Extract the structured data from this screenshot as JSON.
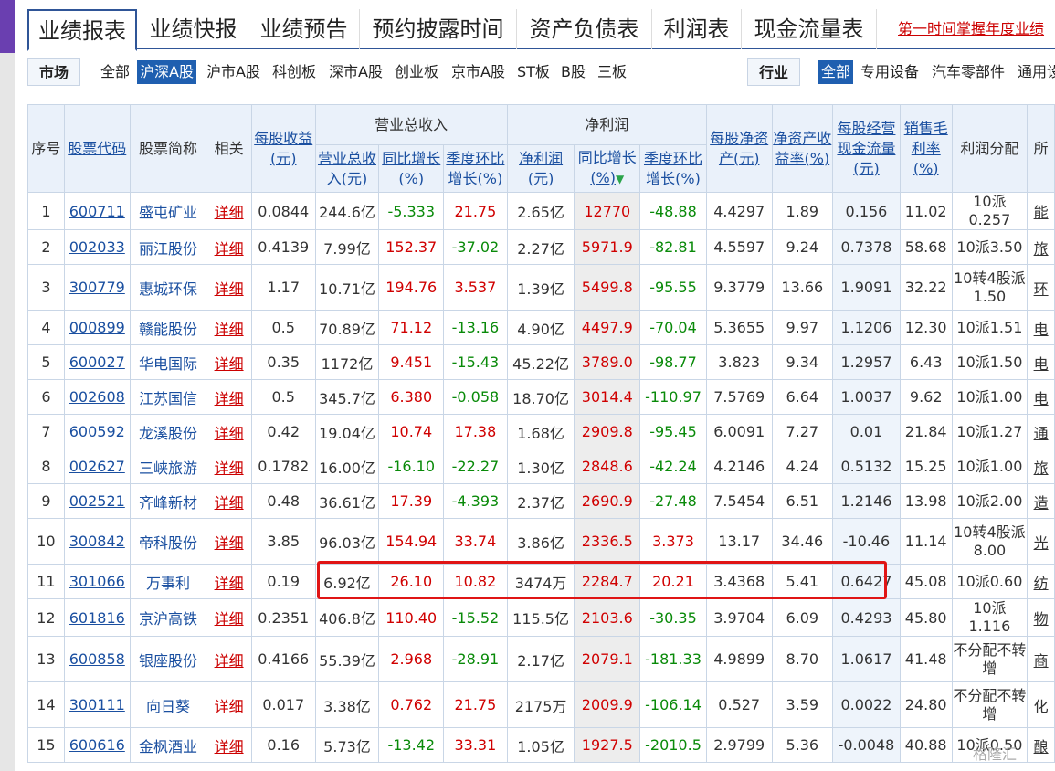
{
  "tabs": [
    "业绩报表",
    "业绩快报",
    "业绩预告",
    "预约披露时间",
    "资产负债表",
    "利润表",
    "现金流量表"
  ],
  "promo": "第一时间掌握年度业绩",
  "market": {
    "label": "市场",
    "items": [
      "全部",
      "沪深A股",
      "沪市A股",
      "科创板",
      "深市A股",
      "创业板",
      "京市A股",
      "ST板",
      "B股",
      "三板"
    ],
    "active": 1
  },
  "industry": {
    "label": "行业",
    "items": [
      "全部",
      "专用设备",
      "汽车零部件",
      "通用设"
    ],
    "active": 0
  },
  "headers": {
    "seq": "序号",
    "code": "股票代码",
    "name": "股票简称",
    "related": "相关",
    "eps": "每股收益(元)",
    "revenue_group": "营业总收入",
    "revenue": "营业总收入(元)",
    "rev_yoy": "同比增长(%)",
    "rev_qoq": "季度环比增长(%)",
    "profit_group": "净利润",
    "profit": "净利润(元)",
    "profit_yoy": "同比增长(%)",
    "profit_qoq": "季度环比增长(%)",
    "bvps": "每股净资产(元)",
    "roe": "净资产收益率(%)",
    "ocfps": "每股经营现金流量(元)",
    "gross": "销售毛利率(%)",
    "dividend": "利润分配",
    "industry": "所"
  },
  "detail_label": "详细",
  "rows": [
    {
      "seq": "1",
      "code": "600711",
      "name": "盛屯矿业",
      "eps": "0.0844",
      "rev": "244.6亿",
      "rev_yoy": "-5.333",
      "rev_qoq": "21.75",
      "profit": "2.65亿",
      "p_yoy": "12770",
      "p_qoq": "-48.88",
      "bvps": "4.4297",
      "roe": "1.89",
      "ocf": "0.156",
      "gross": "11.02",
      "div": "10派0.257",
      "ind": "能"
    },
    {
      "seq": "2",
      "code": "002033",
      "name": "丽江股份",
      "eps": "0.4139",
      "rev": "7.99亿",
      "rev_yoy": "152.37",
      "rev_qoq": "-37.02",
      "profit": "2.27亿",
      "p_yoy": "5971.9",
      "p_qoq": "-82.81",
      "bvps": "4.5597",
      "roe": "9.24",
      "ocf": "0.7378",
      "gross": "58.68",
      "div": "10派3.50",
      "ind": "旅"
    },
    {
      "seq": "3",
      "code": "300779",
      "name": "惠城环保",
      "eps": "1.17",
      "rev": "10.71亿",
      "rev_yoy": "194.76",
      "rev_qoq": "3.537",
      "profit": "1.39亿",
      "p_yoy": "5499.8",
      "p_qoq": "-95.55",
      "bvps": "9.3779",
      "roe": "13.66",
      "ocf": "1.9091",
      "gross": "32.22",
      "div": "10转4股派1.50",
      "ind": "环"
    },
    {
      "seq": "4",
      "code": "000899",
      "name": "赣能股份",
      "eps": "0.5",
      "rev": "70.89亿",
      "rev_yoy": "71.12",
      "rev_qoq": "-13.16",
      "profit": "4.90亿",
      "p_yoy": "4497.9",
      "p_qoq": "-70.04",
      "bvps": "5.3655",
      "roe": "9.97",
      "ocf": "1.1206",
      "gross": "12.30",
      "div": "10派1.51",
      "ind": "电"
    },
    {
      "seq": "5",
      "code": "600027",
      "name": "华电国际",
      "eps": "0.35",
      "rev": "1172亿",
      "rev_yoy": "9.451",
      "rev_qoq": "-15.43",
      "profit": "45.22亿",
      "p_yoy": "3789.0",
      "p_qoq": "-98.77",
      "bvps": "3.823",
      "roe": "9.34",
      "ocf": "1.2957",
      "gross": "6.43",
      "div": "10派1.50",
      "ind": "电"
    },
    {
      "seq": "6",
      "code": "002608",
      "name": "江苏国信",
      "eps": "0.5",
      "rev": "345.7亿",
      "rev_yoy": "6.380",
      "rev_qoq": "-0.058",
      "profit": "18.70亿",
      "p_yoy": "3014.4",
      "p_qoq": "-110.97",
      "bvps": "7.5769",
      "roe": "6.64",
      "ocf": "1.0037",
      "gross": "9.62",
      "div": "10派1.00",
      "ind": "电"
    },
    {
      "seq": "7",
      "code": "600592",
      "name": "龙溪股份",
      "eps": "0.42",
      "rev": "19.04亿",
      "rev_yoy": "10.74",
      "rev_qoq": "17.38",
      "profit": "1.68亿",
      "p_yoy": "2909.8",
      "p_qoq": "-95.45",
      "bvps": "6.0091",
      "roe": "7.27",
      "ocf": "0.01",
      "gross": "21.84",
      "div": "10派1.27",
      "ind": "通"
    },
    {
      "seq": "8",
      "code": "002627",
      "name": "三峡旅游",
      "eps": "0.1782",
      "rev": "16.00亿",
      "rev_yoy": "-16.10",
      "rev_qoq": "-22.27",
      "profit": "1.30亿",
      "p_yoy": "2848.6",
      "p_qoq": "-42.24",
      "bvps": "4.2146",
      "roe": "4.24",
      "ocf": "0.5132",
      "gross": "15.25",
      "div": "10派1.00",
      "ind": "旅"
    },
    {
      "seq": "9",
      "code": "002521",
      "name": "齐峰新材",
      "eps": "0.48",
      "rev": "36.61亿",
      "rev_yoy": "17.39",
      "rev_qoq": "-4.393",
      "profit": "2.37亿",
      "p_yoy": "2690.9",
      "p_qoq": "-27.48",
      "bvps": "7.5454",
      "roe": "6.51",
      "ocf": "1.2146",
      "gross": "13.98",
      "div": "10派2.00",
      "ind": "造"
    },
    {
      "seq": "10",
      "code": "300842",
      "name": "帝科股份",
      "eps": "3.85",
      "rev": "96.03亿",
      "rev_yoy": "154.94",
      "rev_qoq": "33.74",
      "profit": "3.86亿",
      "p_yoy": "2336.5",
      "p_qoq": "3.373",
      "bvps": "13.17",
      "roe": "34.46",
      "ocf": "-10.46",
      "gross": "11.14",
      "div": "10转4股派8.00",
      "ind": "光"
    },
    {
      "seq": "11",
      "code": "301066",
      "name": "万事利",
      "eps": "0.19",
      "rev": "6.92亿",
      "rev_yoy": "26.10",
      "rev_qoq": "10.82",
      "profit": "3474万",
      "p_yoy": "2284.7",
      "p_qoq": "20.21",
      "bvps": "3.4368",
      "roe": "5.41",
      "ocf": "0.6427",
      "gross": "45.08",
      "div": "10派0.60",
      "ind": "纺"
    },
    {
      "seq": "12",
      "code": "601816",
      "name": "京沪高铁",
      "eps": "0.2351",
      "rev": "406.8亿",
      "rev_yoy": "110.40",
      "rev_qoq": "-15.52",
      "profit": "115.5亿",
      "p_yoy": "2103.6",
      "p_qoq": "-30.35",
      "bvps": "3.9704",
      "roe": "6.09",
      "ocf": "0.4293",
      "gross": "45.80",
      "div": "10派1.116",
      "ind": "物"
    },
    {
      "seq": "13",
      "code": "600858",
      "name": "银座股份",
      "eps": "0.4166",
      "rev": "55.39亿",
      "rev_yoy": "2.968",
      "rev_qoq": "-28.91",
      "profit": "2.17亿",
      "p_yoy": "2079.1",
      "p_qoq": "-181.33",
      "bvps": "4.9899",
      "roe": "8.70",
      "ocf": "1.0617",
      "gross": "41.48",
      "div": "不分配不转增",
      "ind": "商"
    },
    {
      "seq": "14",
      "code": "300111",
      "name": "向日葵",
      "eps": "0.017",
      "rev": "3.38亿",
      "rev_yoy": "0.762",
      "rev_qoq": "21.75",
      "profit": "2175万",
      "p_yoy": "2009.9",
      "p_qoq": "-106.14",
      "bvps": "0.527",
      "roe": "3.59",
      "ocf": "0.0022",
      "gross": "24.80",
      "div": "不分配不转增",
      "ind": "化"
    },
    {
      "seq": "15",
      "code": "600616",
      "name": "金枫酒业",
      "eps": "0.16",
      "rev": "5.73亿",
      "rev_yoy": "-13.42",
      "rev_qoq": "33.31",
      "profit": "1.05亿",
      "p_yoy": "1927.5",
      "p_qoq": "-2010.5",
      "bvps": "2.9799",
      "roe": "5.36",
      "ocf": "-0.0048",
      "gross": "40.88",
      "div": "10派0.50",
      "ind": "酿"
    }
  ],
  "watermark": "格隆汇",
  "colors": {
    "up": "#d00000",
    "down": "#098a09",
    "link": "#1a4fa0",
    "accent": "#2f5597",
    "highlight": "#e01515"
  }
}
